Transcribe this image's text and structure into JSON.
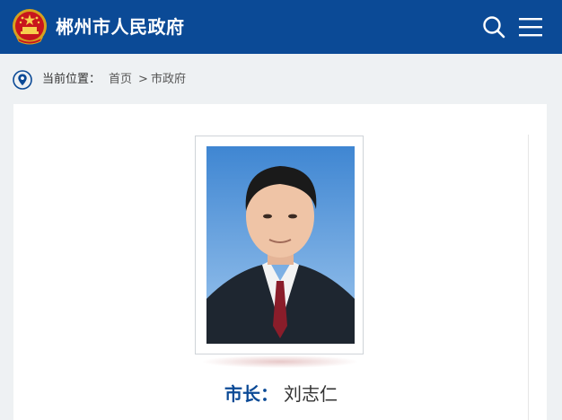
{
  "header": {
    "site_title": "郴州市人民政府",
    "emblem_icon": "national-emblem-icon",
    "search_icon": "search-icon",
    "menu_icon": "hamburger-menu-icon",
    "brand_color": "#0b4a96"
  },
  "breadcrumb": {
    "label": "当前位置：",
    "items": [
      {
        "label": "首页"
      },
      {
        "label": "市政府"
      }
    ],
    "separator": ">",
    "icon": "location-pin-icon"
  },
  "profile": {
    "role_label": "市长：",
    "name": "刘志仁",
    "photo": "official-portrait"
  }
}
